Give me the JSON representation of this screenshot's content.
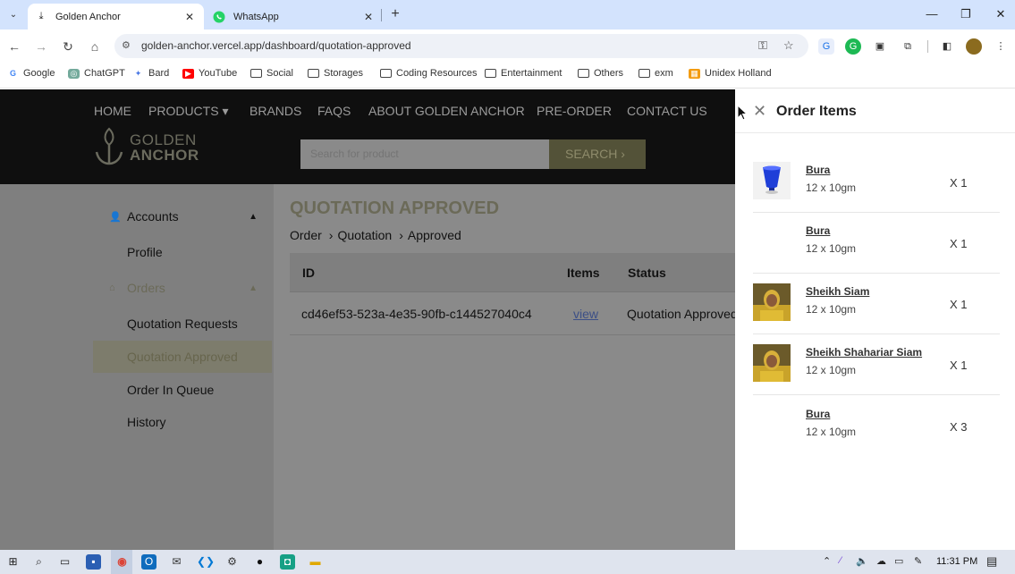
{
  "browser": {
    "tabs": [
      {
        "title": "Golden Anchor",
        "active": true,
        "icon": "download-anchor-icon"
      },
      {
        "title": "WhatsApp",
        "active": false,
        "icon": "whatsapp-icon"
      }
    ],
    "url": "golden-anchor.vercel.app/dashboard/quotation-approved",
    "bookmarks": [
      {
        "label": "Google",
        "icon": "google-icon"
      },
      {
        "label": "ChatGPT",
        "icon": "chatgpt-icon"
      },
      {
        "label": "Bard",
        "icon": "bard-icon"
      },
      {
        "label": "YouTube",
        "icon": "youtube-icon"
      },
      {
        "label": "Social",
        "icon": "folder-icon"
      },
      {
        "label": "Storages",
        "icon": "folder-icon"
      },
      {
        "label": "Coding Resources",
        "icon": "folder-icon"
      },
      {
        "label": "Entertainment",
        "icon": "folder-icon"
      },
      {
        "label": "Others",
        "icon": "folder-icon"
      },
      {
        "label": "exm",
        "icon": "folder-icon"
      },
      {
        "label": "Unidex Holland",
        "icon": "unidex-icon"
      }
    ]
  },
  "site": {
    "nav": [
      "HOME",
      "PRODUCTS",
      "BRANDS",
      "FAQS",
      "ABOUT GOLDEN ANCHOR",
      "PRE-ORDER",
      "CONTACT US"
    ],
    "logo_line1": "GOLDEN",
    "logo_line2": "ANCHOR",
    "search_placeholder": "Search for product",
    "search_button": "SEARCH ›"
  },
  "sidebar": {
    "accounts_label": "Accounts",
    "profile_label": "Profile",
    "orders_label": "Orders",
    "order_items": [
      "Quotation Requests",
      "Quotation Approved",
      "Order In Queue",
      "History"
    ],
    "active_item": "Quotation Approved"
  },
  "main": {
    "title": "QUOTATION APPROVED",
    "breadcrumb": [
      "Order",
      "Quotation",
      "Approved"
    ],
    "columns": [
      "ID",
      "Items",
      "Status"
    ],
    "rows": [
      {
        "id": "cd46ef53-523a-4e35-90fb-c144527040c4",
        "items": "view",
        "status": "Quotation Approved"
      }
    ]
  },
  "drawer": {
    "title": "Order Items",
    "items": [
      {
        "name": "Bura",
        "spec": "12 x 10gm",
        "qty": "X 1",
        "thumb": "blue-cup"
      },
      {
        "name": "Bura",
        "spec": "12 x 10gm",
        "qty": "X 1",
        "thumb": "none"
      },
      {
        "name": "Sheikh Siam",
        "spec": "12 x 10gm",
        "qty": "X 1",
        "thumb": "photo"
      },
      {
        "name": "Sheikh Shahariar Siam",
        "spec": "12 x 10gm",
        "qty": "X 1",
        "thumb": "photo"
      },
      {
        "name": "Bura",
        "spec": "12 x 10gm",
        "qty": "X 3",
        "thumb": "none"
      }
    ]
  },
  "taskbar": {
    "time": "11:31 PM"
  },
  "colors": {
    "accent_olive": "#6b6a58",
    "overlay_gray": "#8a8a8a",
    "header_black": "#0f0f0f",
    "link_blue": "#3c4f86"
  }
}
